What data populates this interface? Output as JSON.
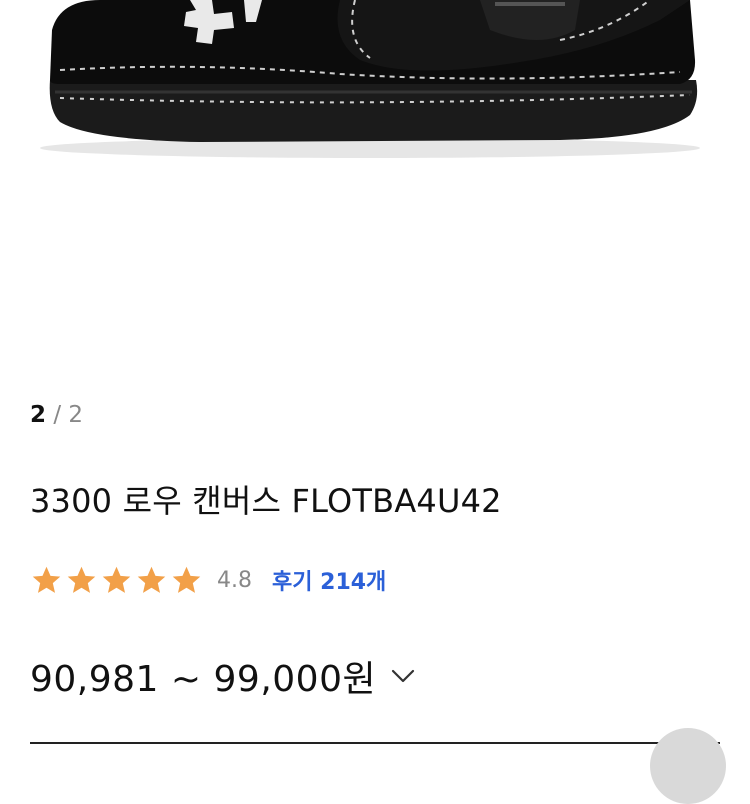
{
  "gallery": {
    "current_index": "2",
    "separator": "/",
    "total": "2"
  },
  "product": {
    "title": "3300 로우 캔버스 FLOTBA4U42",
    "rating": {
      "stars": 4.8,
      "max_stars": 5,
      "score_text": "4.8",
      "review_label": "후기 214개"
    },
    "price_range": "90,981 ~ 99,000원"
  },
  "icons": {
    "star": "star-icon",
    "expand": "chevron-down-icon"
  },
  "colors": {
    "star_fill": "#f2a048",
    "review_link": "#2b60d8",
    "text": "#111111",
    "muted": "#888888"
  }
}
